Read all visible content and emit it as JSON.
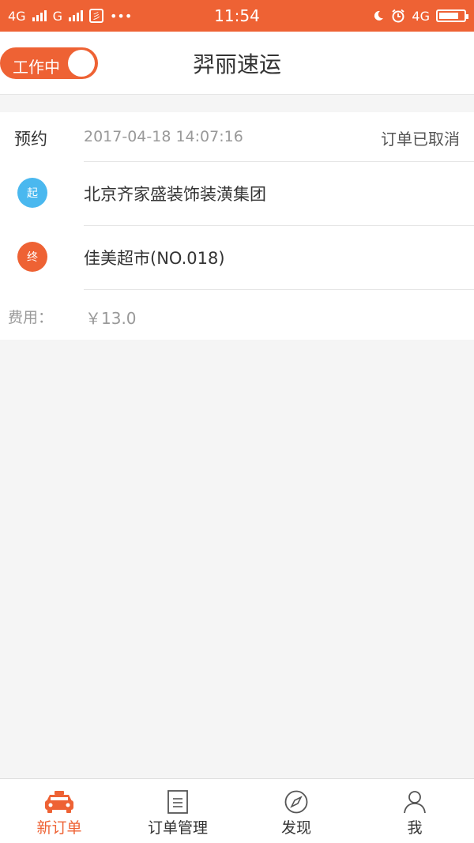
{
  "status_bar": {
    "network_1": "4G",
    "network_2": "G",
    "app_badge": "彡",
    "more": "•••",
    "time": "11:54",
    "network_3": "4G",
    "battery_level": 0.8
  },
  "header": {
    "toggle_label": "工作中",
    "title": "羿丽速运"
  },
  "order": {
    "type": "预约",
    "datetime": "2017-04-18 14:07:16",
    "status": "订单已取消",
    "start_marker": "起",
    "start_place": "北京齐家盛装饰装潢集团",
    "end_marker": "终",
    "end_place": "佳美超市(NO.018)",
    "fee_label": "费用：",
    "fee_value": "￥13.0"
  },
  "tabs": [
    {
      "label": "新订单",
      "icon": "taxi-icon",
      "active": true
    },
    {
      "label": "订单管理",
      "icon": "document-icon",
      "active": false
    },
    {
      "label": "发现",
      "icon": "compass-icon",
      "active": false
    },
    {
      "label": "我",
      "icon": "person-icon",
      "active": false
    }
  ],
  "colors": {
    "accent": "#ee6234",
    "start_marker": "#4ab8ef",
    "end_marker": "#ee6234",
    "background": "#f5f5f5"
  }
}
